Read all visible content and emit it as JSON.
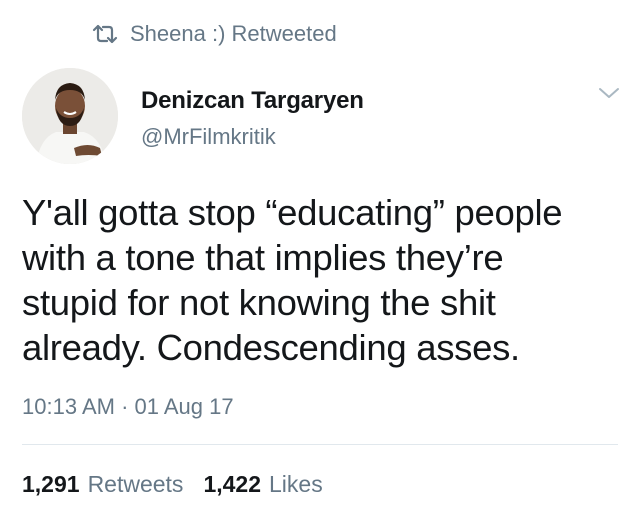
{
  "retweet_context": {
    "icon": "retweet-icon",
    "text": "Sheena :) Retweeted"
  },
  "author": {
    "display_name": "Denizcan Targaryen",
    "handle": "@MrFilmkritik",
    "avatar": "profile-photo"
  },
  "menu": {
    "icon": "chevron-down-icon"
  },
  "tweet": {
    "text": "Y'all gotta stop “educating” people\nwith a tone that implies they’re\nstupid for not knowing the shit\nalready. Condescending asses.",
    "timestamp": "10:13 AM · 01 Aug 17"
  },
  "stats": {
    "retweets_count": "1,291",
    "retweets_label": "Retweets",
    "likes_count": "1,422",
    "likes_label": "Likes"
  },
  "colors": {
    "text_primary": "#14171a",
    "text_secondary": "#657786",
    "divider": "#e1e8ed",
    "background": "#ffffff"
  }
}
